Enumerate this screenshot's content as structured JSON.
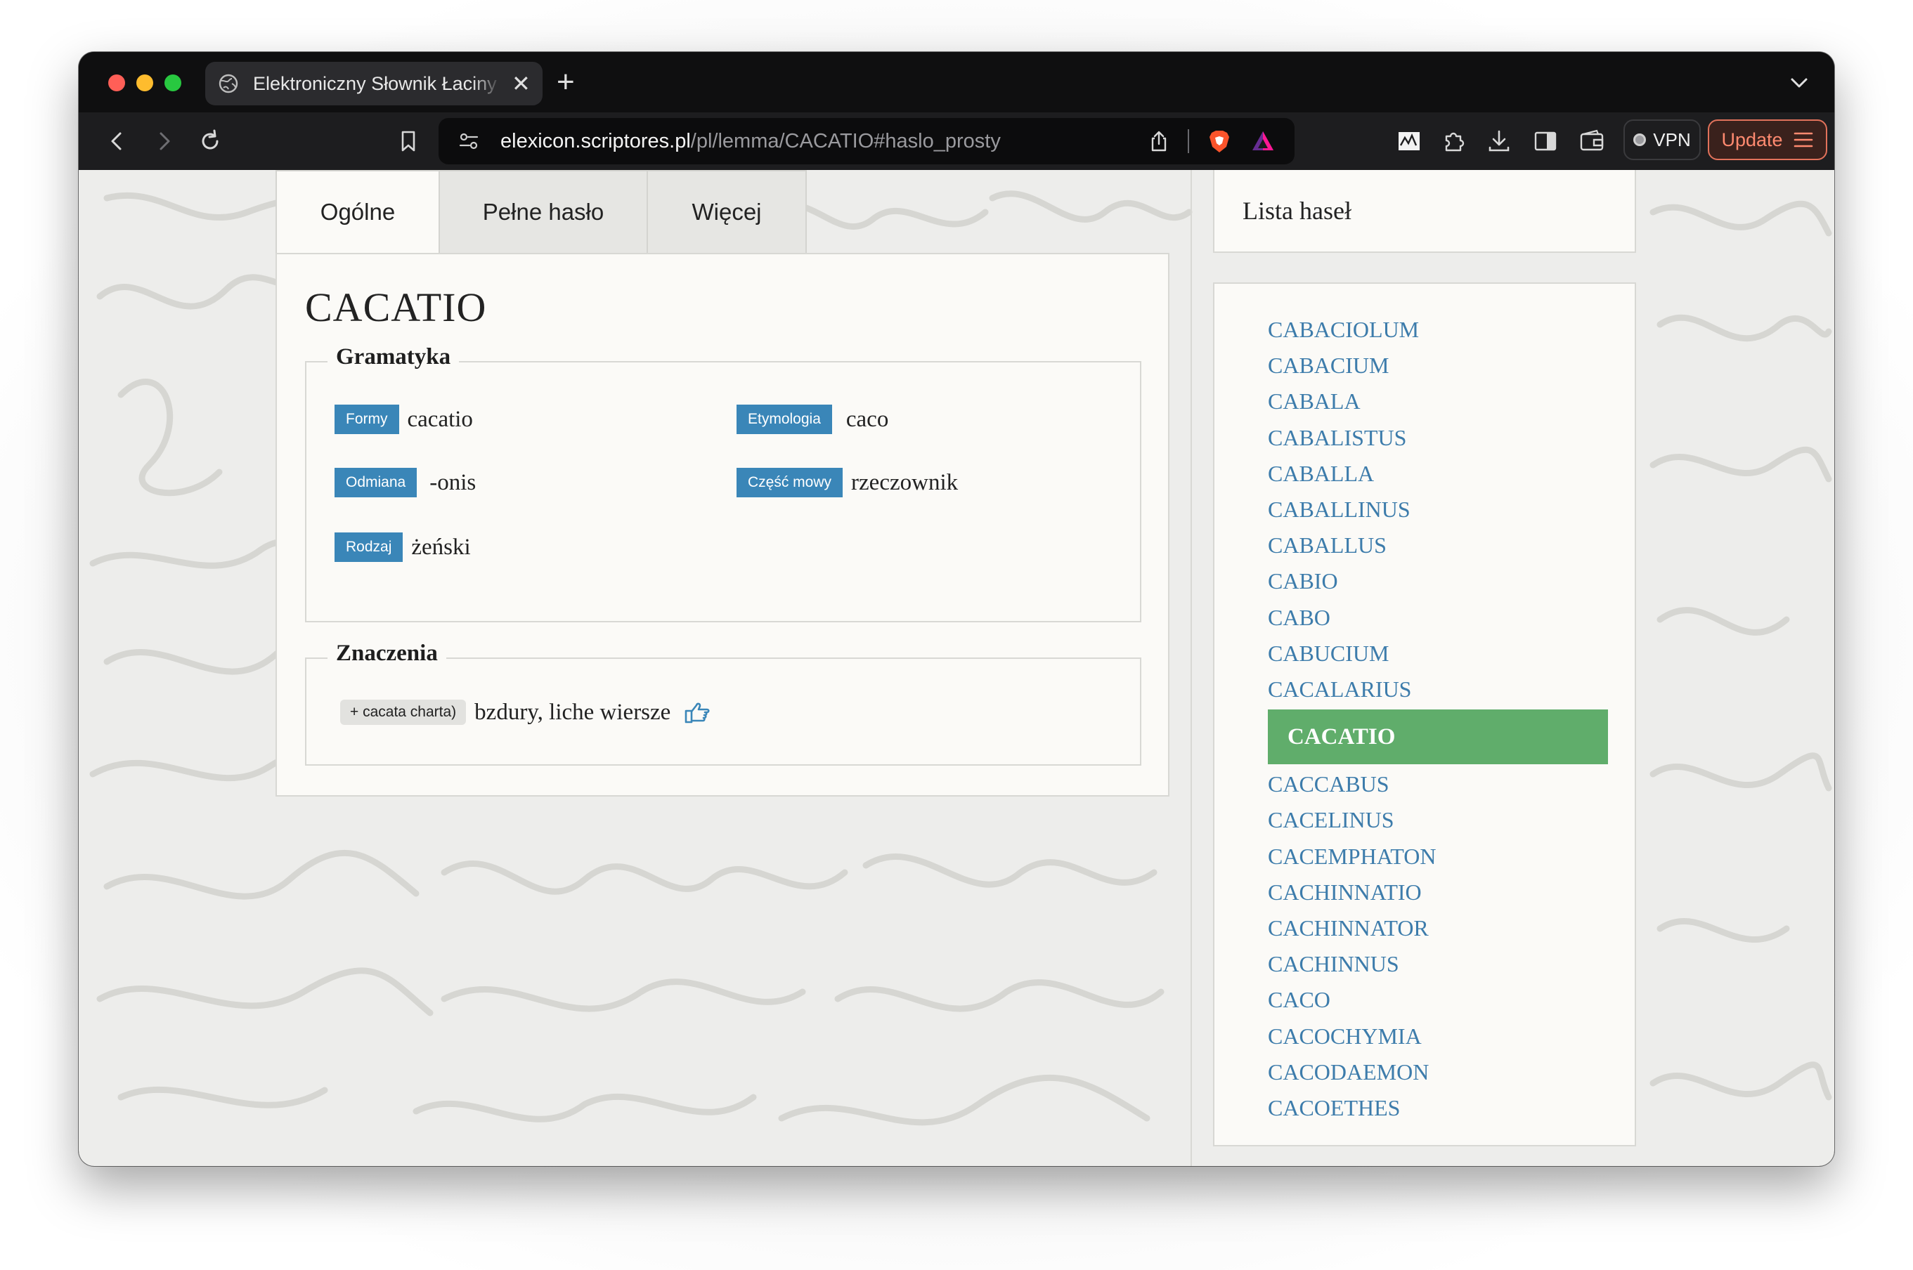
{
  "browser": {
    "tab_title": "Elektroniczny Słownik Łaciny Średniowiecznej",
    "tab_close": "✕",
    "new_tab": "+",
    "url_host": "elexicon.scriptores.pl",
    "url_path": "/pl/lemma/CACATIO#haslo_prosty",
    "vpn_label": "VPN",
    "update_label": "Update"
  },
  "page": {
    "tabs": [
      {
        "label": "Ogólne",
        "active": true
      },
      {
        "label": "Pełne hasło",
        "active": false
      },
      {
        "label": "Więcej",
        "active": false
      }
    ],
    "lemma": "CACATIO",
    "grammar": {
      "legend": "Gramatyka",
      "items": [
        {
          "label": "Formy",
          "value": "cacatio"
        },
        {
          "label": "Etymologia",
          "value": "caco"
        },
        {
          "label": "Odmiana",
          "value": "-onis"
        },
        {
          "label": "Część mowy",
          "value": "rzeczownik"
        },
        {
          "label": "Rodzaj",
          "value": "żeński"
        }
      ]
    },
    "meanings": {
      "legend": "Znaczenia",
      "items": [
        {
          "phrase": "+ cacata charta)",
          "text": "bzdury, liche wiersze"
        }
      ]
    }
  },
  "sidebar": {
    "header": "Lista haseł",
    "active_index": 11,
    "items": [
      "CABACIOLUM",
      "CABACIUM",
      "CABALA",
      "CABALISTUS",
      "CABALLA",
      "CABALLINUS",
      "CABALLUS",
      "CABIO",
      "CABO",
      "CABUCIUM",
      "CACALARIUS",
      "CACATIO",
      "CACCABUS",
      "CACELINUS",
      "CACEMPHATON",
      "CACHINNATIO",
      "CACHINNATOR",
      "CACHINNUS",
      "CACO",
      "CACOCHYMIA",
      "CACODAEMON",
      "CACOETHES"
    ]
  },
  "colors": {
    "badge": "#3a86b8",
    "link": "#3d7cab",
    "active_item": "#60ad6b",
    "update_accent": "#e2725b"
  },
  "icons": {
    "back": "back-arrow-icon",
    "forward": "forward-arrow-icon",
    "reload": "reload-icon",
    "bookmark": "bookmark-icon",
    "share": "share-icon",
    "brave": "brave-lion-icon",
    "rewards": "brave-rewards-icon",
    "extensions": "puzzle-icon",
    "download": "download-icon",
    "sidebar": "sidebar-icon",
    "wallet": "wallet-icon",
    "pointer": "hand-pointer-icon"
  }
}
